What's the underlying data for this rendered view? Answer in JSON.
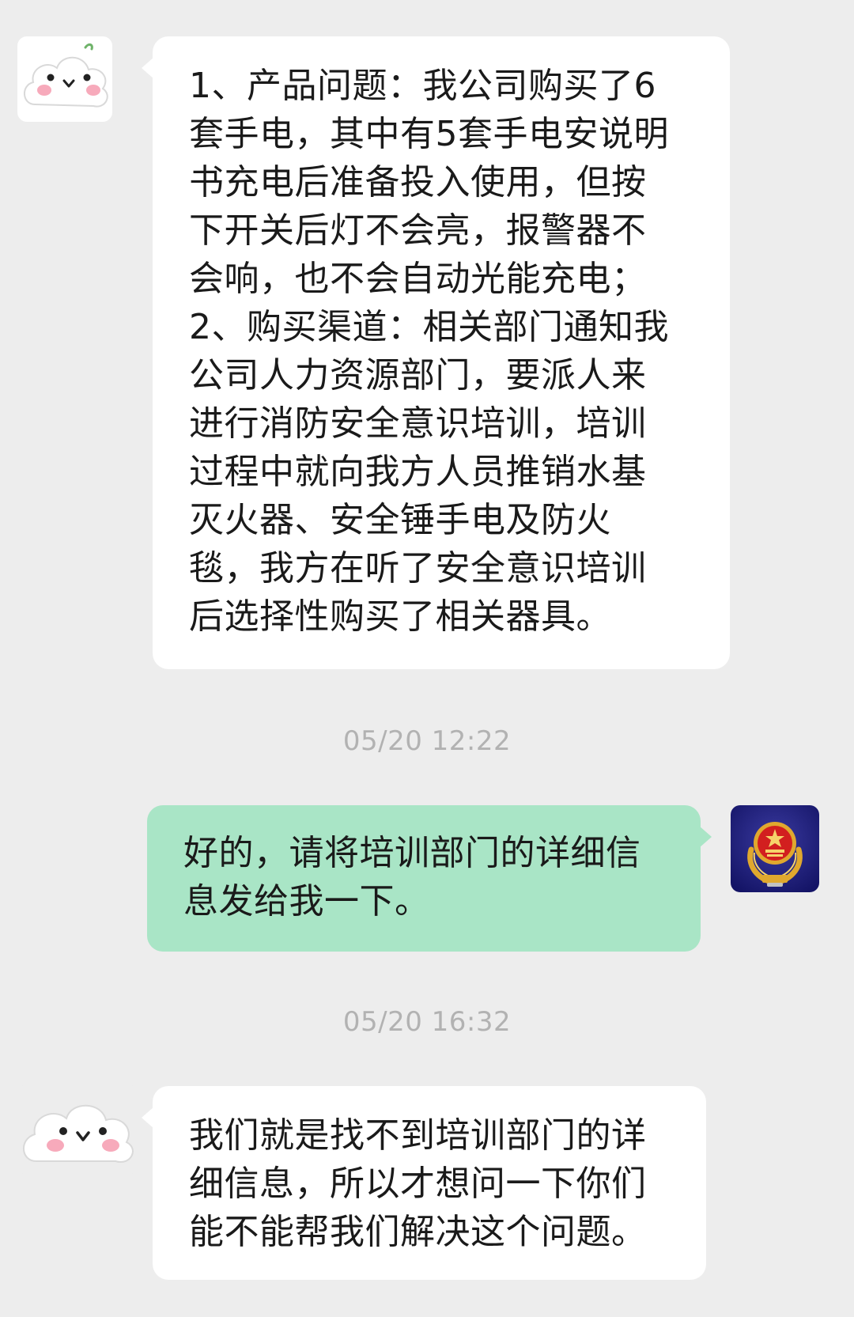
{
  "messages": [
    {
      "side": "left",
      "lines": [
        "1、产品问题：我公司购买了6",
        "套手电，其中有5套手电安说明",
        "书充电后准备投入使用，但按",
        "下开关后灯不会亮，报警器不",
        "会响，也不会自动光能充电；",
        "2、购买渠道：相关部门通知我",
        "公司人力资源部门，要派人来",
        "进行消防安全意识培训，培训",
        "过程中就向我方人员推销水基",
        "灭火器、安全锤手电及防火",
        "毯，我方在听了安全意识培训",
        "后选择性购买了相关器具。"
      ]
    },
    {
      "side": "right",
      "lines": [
        "好的，请将培训部门的详细信",
        "息发给我一下。"
      ]
    },
    {
      "side": "left",
      "lines": [
        "我们就是找不到培训部门的详",
        "细信息，所以才想问一下你们",
        "能不能帮我们解决这个问题。"
      ]
    }
  ],
  "timestamps": [
    "05/20 12:22",
    "05/20 16:32"
  ],
  "avatars": {
    "user": "cloud-face-icon",
    "official": "fire-rescue-emblem-icon"
  },
  "colors": {
    "background": "#ededed",
    "bubble_received": "#ffffff",
    "bubble_sent": "#a9e5c6",
    "text": "#1a1a1a",
    "timestamp": "#b2b2b2"
  }
}
